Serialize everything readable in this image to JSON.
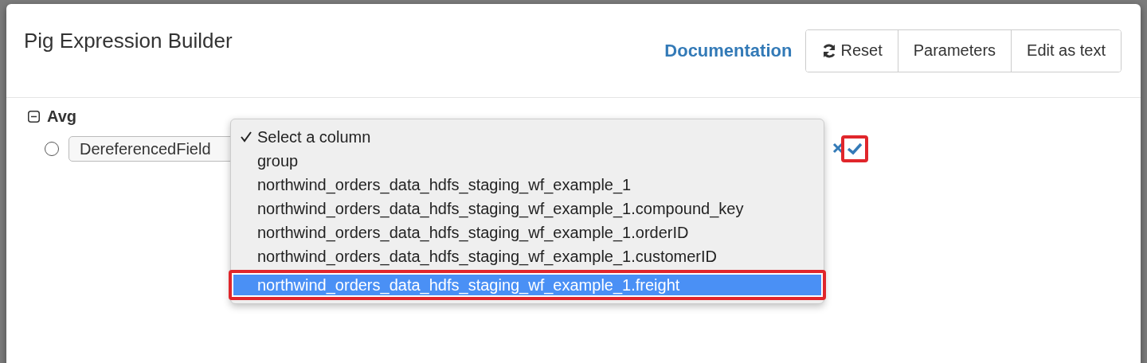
{
  "dialog": {
    "title": "Pig Expression Builder",
    "documentation_link": "Documentation",
    "buttons": [
      {
        "label": "Reset",
        "kind": "reset"
      },
      {
        "label": "Parameters",
        "kind": "plain"
      },
      {
        "label": "Edit as text",
        "kind": "plain"
      }
    ]
  },
  "tree": {
    "label": "Avg",
    "expanded": true,
    "children": [
      {
        "field": "DereferencedField",
        "selected": false,
        "confirm_annotated": true,
        "options": [
          {
            "label": "Select a column",
            "checked": true,
            "highlighted": false,
            "annotated": false
          },
          {
            "label": "group",
            "checked": false,
            "highlighted": false,
            "annotated": false
          },
          {
            "label": "northwind_orders_data_hdfs_staging_wf_example_1",
            "checked": false,
            "highlighted": false,
            "annotated": false
          },
          {
            "label": "northwind_orders_data_hdfs_staging_wf_example_1.compound_key",
            "checked": false,
            "highlighted": false,
            "annotated": false
          },
          {
            "label": "northwind_orders_data_hdfs_staging_wf_example_1.orderID",
            "checked": false,
            "highlighted": false,
            "annotated": false
          },
          {
            "label": "northwind_orders_data_hdfs_staging_wf_example_1.customerID",
            "checked": false,
            "highlighted": false,
            "annotated": false
          },
          {
            "label": "northwind_orders_data_hdfs_staging_wf_example_1.freight",
            "checked": false,
            "highlighted": true,
            "annotated": true
          }
        ]
      }
    ]
  }
}
